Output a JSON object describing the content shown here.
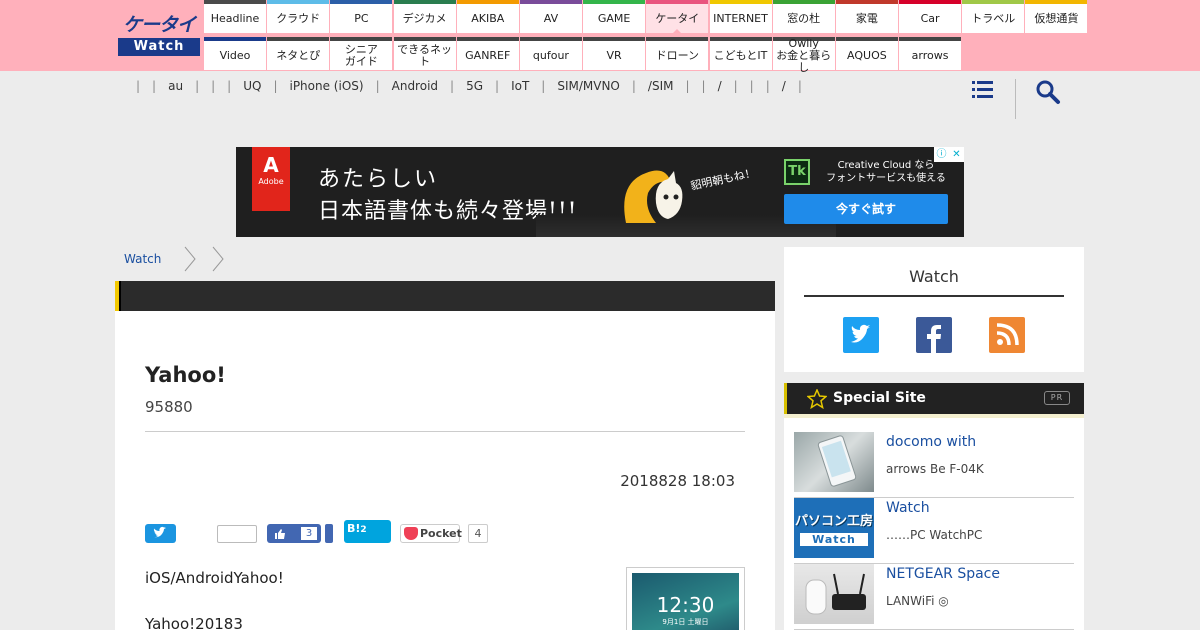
{
  "logo": {
    "top": "ケータイ",
    "bottom": "Watch"
  },
  "nav": {
    "row1": [
      {
        "label": "Headline",
        "color": "#4a4a4a"
      },
      {
        "label": "クラウド",
        "color": "#5dbce8"
      },
      {
        "label": "PC",
        "color": "#2b5fa8"
      },
      {
        "label": "デジカメ",
        "color": "#2a7d4f"
      },
      {
        "label": "AKIBA",
        "color": "#f39a00"
      },
      {
        "label": "AV",
        "color": "#7a4c9a"
      },
      {
        "label": "GAME",
        "color": "#33b54a"
      },
      {
        "label": "ケータイ",
        "color": "#e9547e",
        "active": true
      },
      {
        "label": "INTERNET",
        "color": "#f0c800"
      },
      {
        "label": "窓の杜",
        "color": "#3aa335"
      },
      {
        "label": "家電",
        "color": "#c0392b"
      },
      {
        "label": "Car",
        "color": "#d6002a"
      },
      {
        "label": "トラベル",
        "color": "#a0c848"
      },
      {
        "label": "仮想通貨",
        "color": "#f2b600"
      }
    ],
    "row2": [
      {
        "label": "Video",
        "color": "#1a3a8a"
      },
      {
        "label": "ネタとぴ",
        "color": "#444444"
      },
      {
        "label": "シニア\nガイド",
        "color": "#444444"
      },
      {
        "label": "できるネット",
        "color": "#444444"
      },
      {
        "label": "GANREF",
        "color": "#444444"
      },
      {
        "label": "qufour",
        "color": "#444444"
      },
      {
        "label": "VR",
        "color": "#444444"
      },
      {
        "label": "ドローン",
        "color": "#444444"
      },
      {
        "label": "こどもとIT",
        "color": "#444444"
      },
      {
        "label": "Owlly\nお金と暮らし",
        "color": "#444444"
      },
      {
        "label": "AQUOS",
        "color": "#444444"
      },
      {
        "label": "arrows",
        "color": "#444444"
      }
    ]
  },
  "subnav": [
    "",
    "au",
    "",
    "",
    "UQ",
    "iPhone (iOS)",
    "Android",
    "5G",
    "IoT",
    "SIM/MVNO",
    "/SIM",
    "",
    "/",
    "",
    "",
    "/",
    ""
  ],
  "ad": {
    "brand": "Adobe",
    "line1": "あたらしい",
    "line2": "日本語書体も続々登場!!!",
    "slogan": "貂明朝もね！",
    "tk": "Tk",
    "cc_text": "Creative Cloud なら\nフォントサービスも使える",
    "button": "今すぐ試す"
  },
  "breadcrumb": [
    "Watch",
    "",
    ""
  ],
  "article": {
    "title": "Yahoo!",
    "subtitle": "95880",
    "date": "2018828 18:03",
    "share": {
      "like_count": "3",
      "hatena": "B!",
      "hatena_count": "2",
      "pocket": "Pocket",
      "pocket_count": "4"
    },
    "p1": "iOS/AndroidYahoo!",
    "p2": "Yahoo!20183",
    "image": {
      "time": "12:30",
      "date": "9月1日 土曜日"
    }
  },
  "sidebar": {
    "follow_title": "Watch",
    "special_title": "Special Site",
    "pr_badge": "PR",
    "items": [
      {
        "title": "docomo with",
        "desc": "arrows Be F-04K"
      },
      {
        "title": " Watch",
        "desc": "……PC WatchPC",
        "thumb_top": "パソコン工房",
        "thumb_bottom": "Watch"
      },
      {
        "title": "NETGEAR Space",
        "desc": "LANWiFi ◎"
      }
    ]
  }
}
